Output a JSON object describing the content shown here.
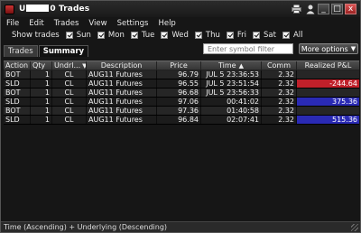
{
  "window": {
    "title_prefix": "U",
    "title_suffix": "0 Trades",
    "minimize": "_",
    "restore": "□",
    "close": "x"
  },
  "menu": [
    "File",
    "Edit",
    "Trades",
    "View",
    "Settings",
    "Help"
  ],
  "show_trades": {
    "label": "Show trades",
    "options": [
      "Sun",
      "Mon",
      "Tue",
      "Wed",
      "Thu",
      "Fri",
      "Sat",
      "All"
    ]
  },
  "tabs": [
    "Trades",
    "Summary"
  ],
  "filter": {
    "placeholder": "Enter symbol filter"
  },
  "more_options": "More options",
  "table": {
    "headers": [
      "Action",
      "Qty",
      "Undrl...",
      "Description",
      "Price",
      "Time",
      "Comm",
      "Realized P&L"
    ],
    "rows": [
      {
        "action": "BOT",
        "qty": "1",
        "und": "CL",
        "desc": "AUG11 Futures",
        "price": "96.79",
        "time": "JUL 5 23:36:53",
        "comm": "2.32",
        "pnl": ""
      },
      {
        "action": "SLD",
        "qty": "1",
        "und": "CL",
        "desc": "AUG11 Futures",
        "price": "96.55",
        "time": "JUL 5 23:51:54",
        "comm": "2.32",
        "pnl": "-244.64"
      },
      {
        "action": "BOT",
        "qty": "1",
        "und": "CL",
        "desc": "AUG11 Futures",
        "price": "96.68",
        "time": "JUL 5 23:56:33",
        "comm": "2.32",
        "pnl": ""
      },
      {
        "action": "SLD",
        "qty": "1",
        "und": "CL",
        "desc": "AUG11 Futures",
        "price": "97.06",
        "time": "00:41:02",
        "comm": "2.32",
        "pnl": "375.36"
      },
      {
        "action": "BOT",
        "qty": "1",
        "und": "CL",
        "desc": "AUG11 Futures",
        "price": "97.36",
        "time": "01:40:58",
        "comm": "2.32",
        "pnl": ""
      },
      {
        "action": "SLD",
        "qty": "1",
        "und": "CL",
        "desc": "AUG11 Futures",
        "price": "96.84",
        "time": "02:07:41",
        "comm": "2.32",
        "pnl": "515.36"
      }
    ]
  },
  "status": "Time (Ascending) + Underlying (Descending)",
  "colors": {
    "loss": "#c0202a",
    "gain": "#2a2ab4",
    "background": "#161616"
  },
  "icons": {
    "printer": "printer-icon",
    "person": "person-icon",
    "sort_up": "sort-ascending-icon"
  }
}
